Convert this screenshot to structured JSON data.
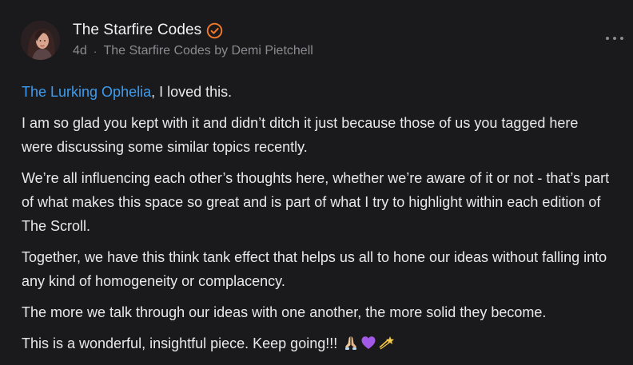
{
  "post": {
    "author_name": "The Starfire Codes",
    "verified_icon": "verified-badge-icon",
    "time_ago": "4d",
    "separator": "·",
    "publication": "The Starfire Codes by Demi Pietchell",
    "accent_color": "#3d9cf0",
    "badge_color": "#f27a2a"
  },
  "comment": {
    "mention": "The Lurking Ophelia",
    "mention_suffix": ", I loved this.",
    "paragraphs": [
      "I am so glad you kept with it and didn’t ditch it just because those of us you tagged here were discussing some similar topics recently.",
      "We’re all influencing each other’s thoughts here, whether we’re aware of it or not - that’s part of what makes this space so great and is part of what I try to highlight within each edition of The Scroll.",
      "Together, we have this think tank effect that helps us all to hone our ideas without falling into any kind of homogeneity or complacency.",
      "The more we talk through our ideas with one another, the more solid they become."
    ],
    "closing": "This is a wonderful, insightful piece. Keep going!!!",
    "closing_emojis": [
      "praying-hands-icon",
      "purple-heart-icon",
      "dizzy-star-icon"
    ]
  }
}
